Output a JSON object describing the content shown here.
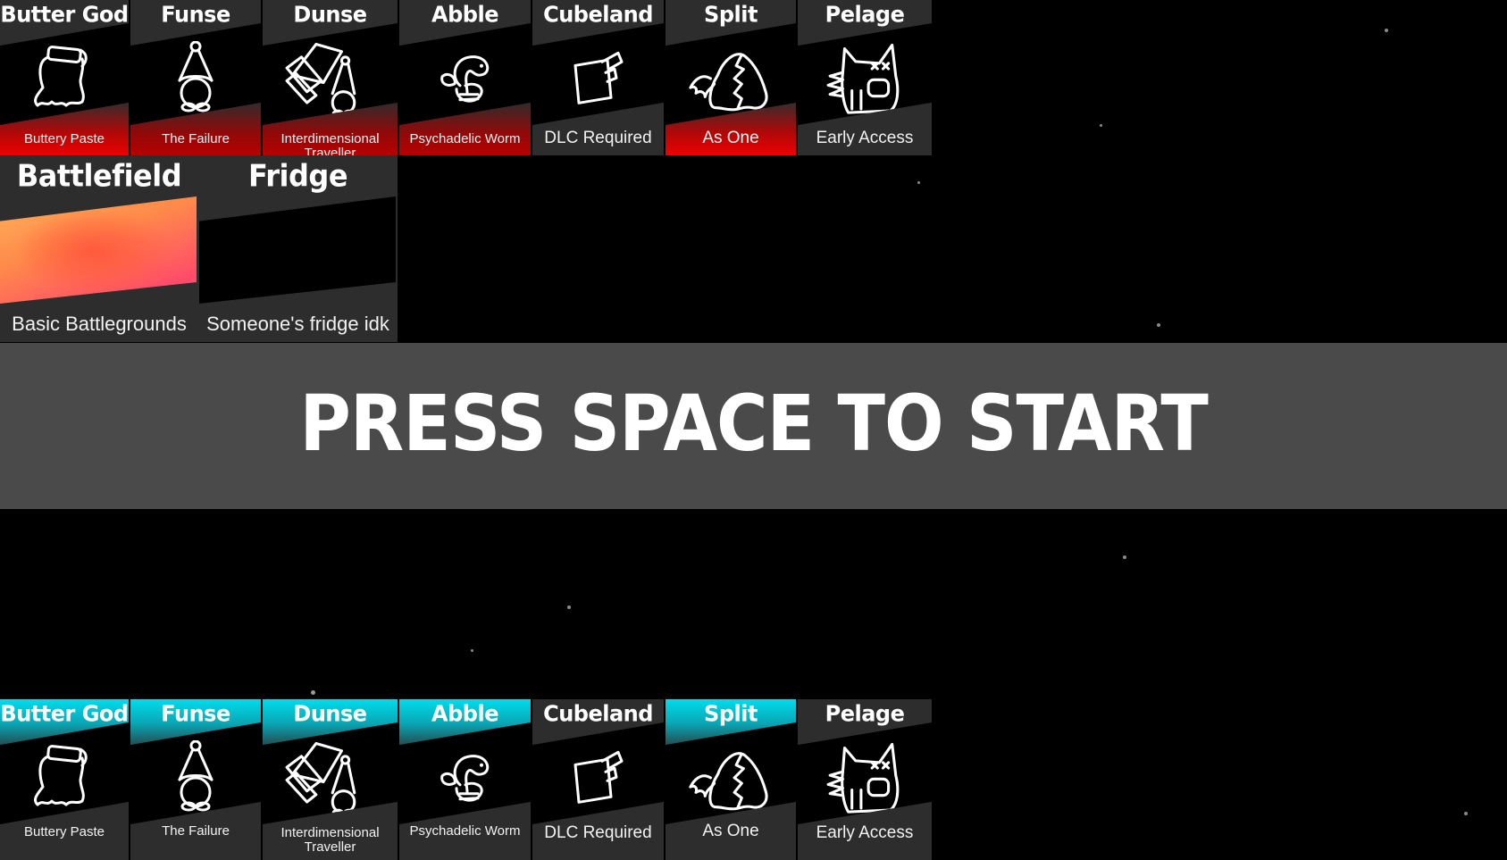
{
  "screen": "character-and-map-select",
  "prompt": "PRESS SPACE TO START",
  "colors": {
    "background": "#000000",
    "cell": "#2d2d2d",
    "start_band": "#4a4a4a",
    "player1_highlight": "#ee0000",
    "player2_highlight": "#00dcec"
  },
  "player1_characters": [
    {
      "name": "Butter God",
      "subtitle": "Buttery Paste",
      "icon": "butter-god-icon",
      "highlight": "red-strong"
    },
    {
      "name": "Funse",
      "subtitle": "The Failure",
      "icon": "funse-icon",
      "highlight": "red-dark"
    },
    {
      "name": "Dunse",
      "subtitle": "Interdimensional Traveller",
      "icon": "dunse-icon",
      "highlight": "red-dark"
    },
    {
      "name": "Abble",
      "subtitle": "Psychadelic Worm",
      "icon": "abble-icon",
      "highlight": "red-dark"
    },
    {
      "name": "Cubeland",
      "subtitle": "DLC Required",
      "icon": "cubeland-icon",
      "highlight": "none"
    },
    {
      "name": "Split",
      "subtitle": "As One",
      "icon": "split-icon",
      "highlight": "red-strong"
    },
    {
      "name": "Pelage",
      "subtitle": "Early Access",
      "icon": "pelage-icon",
      "highlight": "none"
    }
  ],
  "maps": [
    {
      "name": "Battlefield",
      "subtitle": "Basic Battlegrounds",
      "icon": "battlefield-preview"
    },
    {
      "name": "Fridge",
      "subtitle": "Someone's fridge idk",
      "icon": "fridge-preview"
    }
  ],
  "player2_characters": [
    {
      "name": "Butter God",
      "subtitle": "Buttery Paste",
      "icon": "butter-god-icon",
      "highlight": "cyan"
    },
    {
      "name": "Funse",
      "subtitle": "The Failure",
      "icon": "funse-icon",
      "highlight": "cyan"
    },
    {
      "name": "Dunse",
      "subtitle": "Interdimensional Traveller",
      "icon": "dunse-icon",
      "highlight": "cyan"
    },
    {
      "name": "Abble",
      "subtitle": "Psychadelic Worm",
      "icon": "abble-icon",
      "highlight": "cyan"
    },
    {
      "name": "Cubeland",
      "subtitle": "DLC Required",
      "icon": "cubeland-icon",
      "highlight": "none"
    },
    {
      "name": "Split",
      "subtitle": "As One",
      "icon": "split-icon",
      "highlight": "cyan"
    },
    {
      "name": "Pelage",
      "subtitle": "Early Access",
      "icon": "pelage-icon",
      "highlight": "none"
    }
  ]
}
